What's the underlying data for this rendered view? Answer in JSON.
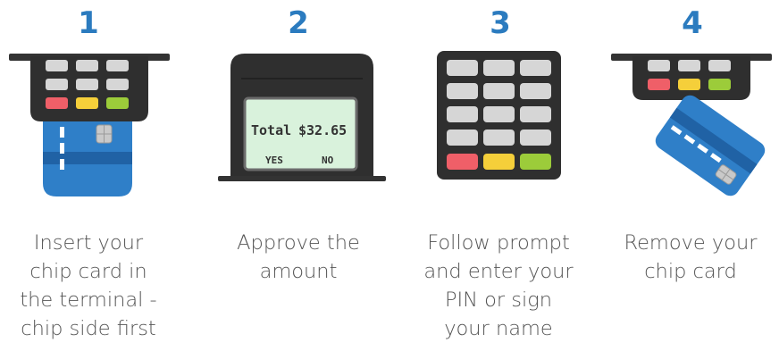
{
  "steps": [
    {
      "number": "1",
      "caption": "Insert your\nchip card in\nthe terminal -\nchip side first"
    },
    {
      "number": "2",
      "caption": "Approve  the\namount"
    },
    {
      "number": "3",
      "caption": "Follow prompt\nand enter your\nPIN or sign\nyour name"
    },
    {
      "number": "4",
      "caption": "Remove your\nchip card"
    }
  ],
  "screen": {
    "total_label": "Total",
    "amount": "$32.65",
    "yes_label": "YES",
    "no_label": "NO"
  },
  "colors": {
    "accent": "#2b7bbf",
    "terminal_dark": "#2f2f2f",
    "key_grey": "#d6d6d6",
    "key_red": "#ef5f68",
    "key_yellow": "#f5cf3a",
    "key_green": "#9ccc3a",
    "card_blue": "#2f7fc8",
    "card_stripe": "#2062a5",
    "screen_green": "#d9f2dc",
    "text_grey": "#555555"
  }
}
